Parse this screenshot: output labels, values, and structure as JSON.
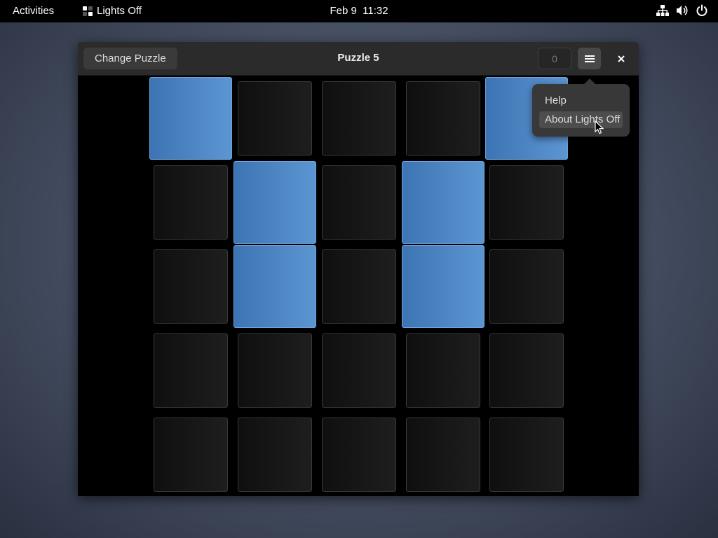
{
  "topbar": {
    "activities": "Activities",
    "app_name": "Lights Off",
    "clock": "Feb 9  11:32",
    "tray_icons": [
      "network-icon",
      "volume-icon",
      "power-icon"
    ]
  },
  "window": {
    "change_puzzle_label": "Change Puzzle",
    "title": "Puzzle 5",
    "move_count": "0",
    "menu_icon": "hamburger-menu-icon",
    "close_icon": "close-icon"
  },
  "board": {
    "rows": 5,
    "cols": 5,
    "lit": [
      [
        true,
        false,
        false,
        false,
        true
      ],
      [
        false,
        true,
        false,
        true,
        false
      ],
      [
        false,
        true,
        false,
        true,
        false
      ],
      [
        false,
        false,
        false,
        false,
        false
      ],
      [
        false,
        false,
        false,
        false,
        false
      ]
    ],
    "on_color": "#4a85c4",
    "off_color": "#141414"
  },
  "menu": {
    "items": [
      {
        "label": "Help"
      },
      {
        "label": "About Lights Off",
        "highlighted": true
      }
    ]
  }
}
